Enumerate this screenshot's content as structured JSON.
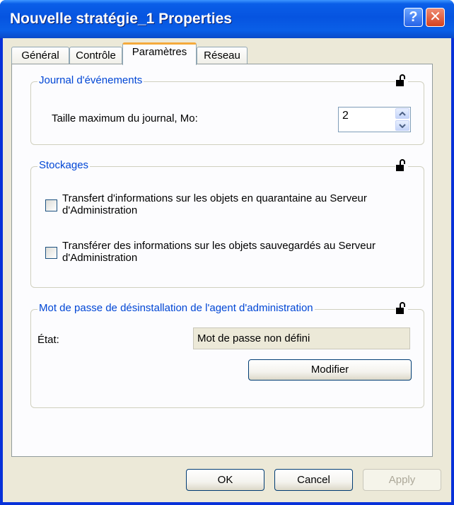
{
  "window": {
    "title": "Nouvelle stratégie_1 Properties",
    "help_glyph": "?",
    "close_glyph": "✕"
  },
  "tabs": [
    {
      "label": "Général",
      "active": false
    },
    {
      "label": "Contrôle",
      "active": false
    },
    {
      "label": "Paramètres",
      "active": true
    },
    {
      "label": "Réseau",
      "active": false
    }
  ],
  "event_log": {
    "legend": "Journal d'événements",
    "max_size_label": "Taille maximum du journal, Mo:",
    "max_size_value": "2"
  },
  "storages": {
    "legend": "Stockages",
    "quarantine_label": "Transfert d'informations sur les objets en quarantaine au Serveur d'Administration",
    "quarantine_checked": false,
    "backup_label": "Transférer des informations sur les objets sauvegardés au Serveur d'Administration",
    "backup_checked": false
  },
  "uninstall_password": {
    "legend": "Mot de passe de désinstallation de l'agent d'administration",
    "state_label": "État:",
    "state_value": "Mot de passe non défini",
    "modify_label": "Modifier"
  },
  "buttons": {
    "ok": "OK",
    "cancel": "Cancel",
    "apply": "Apply",
    "apply_enabled": false
  },
  "colors": {
    "titlebar": "#0a5ee8",
    "group_legend": "#0046d5",
    "dialog_bg": "#ece9d8",
    "active_tab_accent": "#f5aa3c"
  }
}
